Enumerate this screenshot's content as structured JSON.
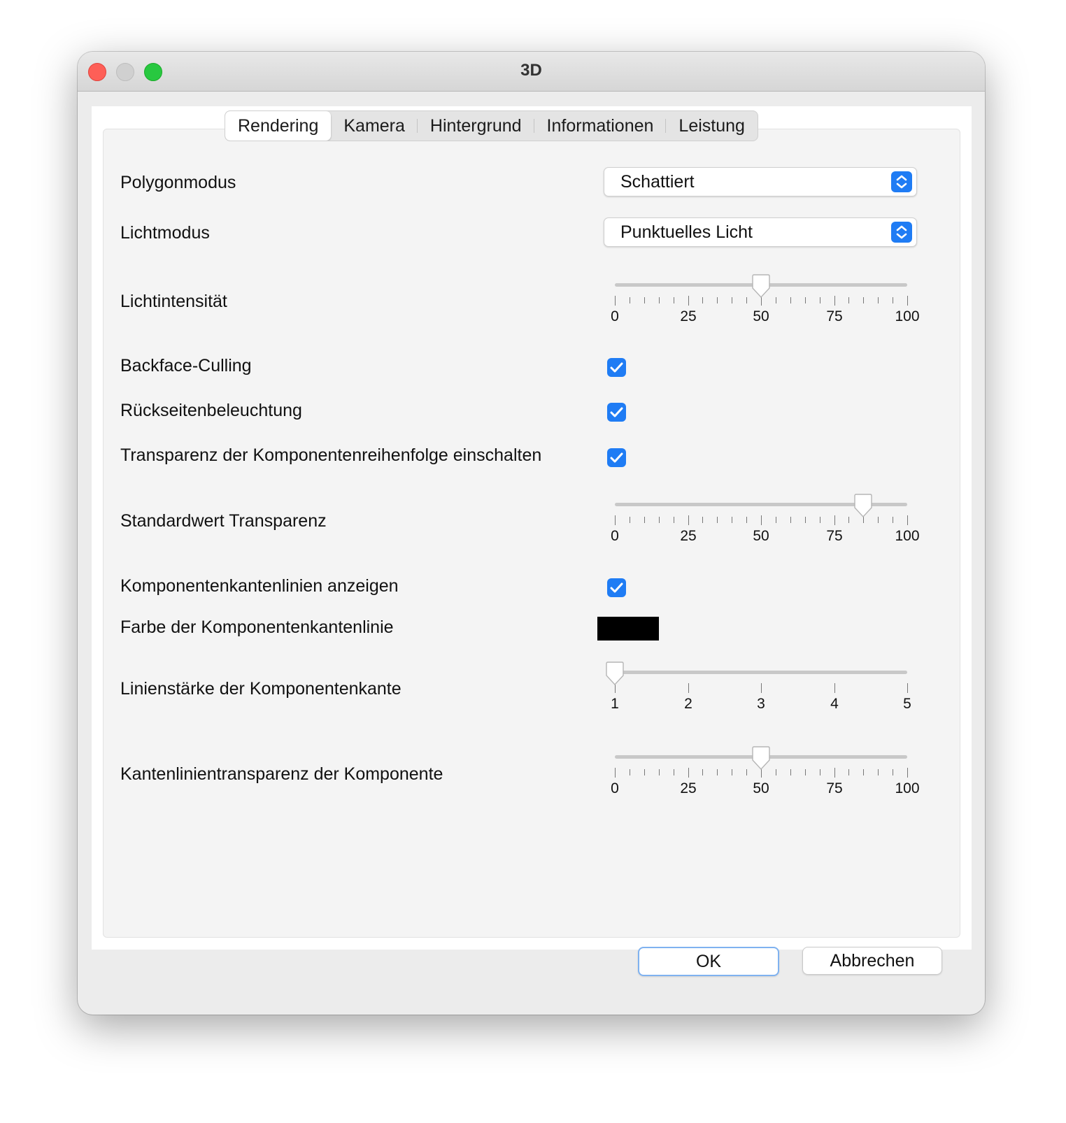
{
  "window": {
    "title": "3D"
  },
  "tabs": [
    {
      "label": "Rendering",
      "active": true
    },
    {
      "label": "Kamera"
    },
    {
      "label": "Hintergrund"
    },
    {
      "label": "Informationen"
    },
    {
      "label": "Leistung"
    }
  ],
  "polygon": {
    "label": "Polygonmodus",
    "value": "Schattiert"
  },
  "light_mode": {
    "label": "Lichtmodus",
    "value": "Punktuelles Licht"
  },
  "light_intensity": {
    "label": "Lichtintensität",
    "value": 50,
    "min": 0,
    "max": 100,
    "ticks": [
      "0",
      "25",
      "50",
      "75",
      "100"
    ]
  },
  "backface": {
    "label": "Backface-Culling",
    "checked": true
  },
  "backlight": {
    "label": "Rückseitenbeleuchtung",
    "checked": true
  },
  "order_transparency": {
    "label": "Transparenz der Komponentenreihenfolge einschalten",
    "checked": true
  },
  "default_transparency": {
    "label": "Standardwert Transparenz",
    "value": 85,
    "min": 0,
    "max": 100,
    "ticks": [
      "0",
      "25",
      "50",
      "75",
      "100"
    ]
  },
  "edge_lines": {
    "label": "Komponentenkantenlinien anzeigen",
    "checked": true
  },
  "edge_color": {
    "label": "Farbe der Komponentenkantenlinie",
    "color": "#000000"
  },
  "edge_width": {
    "label": "Linienstärke der Komponentenkante",
    "value": 1,
    "min": 1,
    "max": 5,
    "ticks": [
      "1",
      "2",
      "3",
      "4",
      "5"
    ]
  },
  "edge_transparency": {
    "label": "Kantenlinientransparenz der Komponente",
    "value": 50,
    "min": 0,
    "max": 100,
    "ticks": [
      "0",
      "25",
      "50",
      "75",
      "100"
    ]
  },
  "buttons": {
    "ok": "OK",
    "cancel": "Abbrechen"
  },
  "colors": {
    "accent": "#1f7cf4",
    "close": "#fe5f57",
    "zoom": "#28c840"
  }
}
